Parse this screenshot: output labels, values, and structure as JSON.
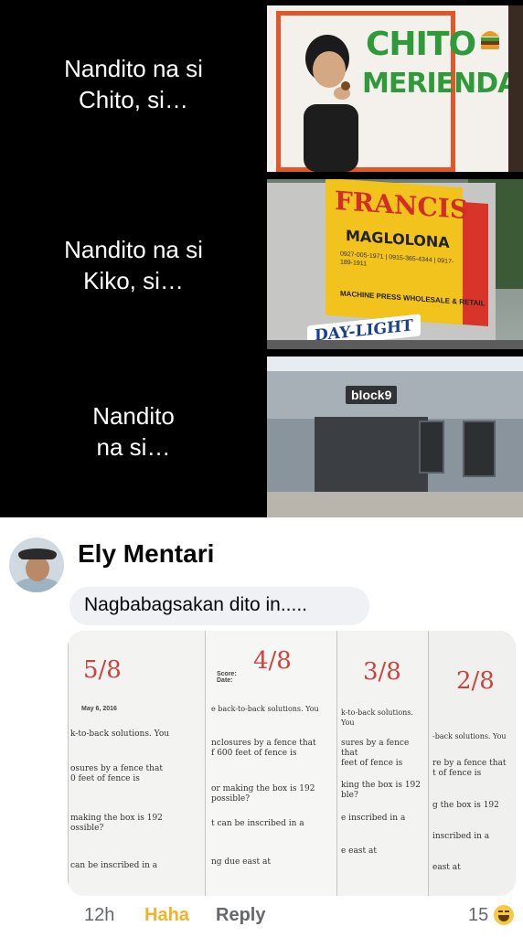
{
  "meme": {
    "rows": [
      {
        "text": "Nandito na si\nChito, si…"
      },
      {
        "text": "Nandito na si\nKiko, si…"
      },
      {
        "text": "Nandito\nna si…"
      }
    ],
    "panel1": {
      "brand_line1": "CHITO",
      "brand_line2": "MERIENDA"
    },
    "panel2": {
      "title": "FRANCIS",
      "subtitle": "MAGLOLONA",
      "contact": "0927-005-1971 | 0915-365-4344 | 0917-189-1911",
      "footer": "MACHINE PRESS WHOLESALE & RETAIL",
      "daylight": "DAY-LIGHT"
    },
    "panel3": {
      "logo": "block9"
    }
  },
  "comment": {
    "author": "Ely Mentari",
    "text": "Nagbabagsakan dito in.....",
    "photo": {
      "sheets": [
        {
          "score": "5/8",
          "date": "May 6, 2016",
          "lines": [
            "k-to-back solutions. You",
            "osures by a fence that\n0 feet of fence is",
            "making the box is 192\nossible?",
            "can be inscribed in a"
          ]
        },
        {
          "score": "4/8",
          "date": "Score:\nDate:",
          "lines": [
            "e back-to-back solutions. You",
            "nclosures by a fence that\nf 600 feet of fence is",
            "or making the box is 192\npossible?",
            "t can be inscribed in a",
            "ng due east at"
          ]
        },
        {
          "score": "3/8",
          "date": "",
          "lines": [
            "k-to-back solutions. You",
            "sures by a fence that\nfeet of fence is",
            "king the box is 192\nble?",
            "e inscribed in a",
            "e east at"
          ]
        },
        {
          "score": "2/8",
          "date": "",
          "lines": [
            "-back solutions. You",
            "re by a fence that\nt of fence is",
            "g the box is 192",
            "inscribed in a",
            "east at"
          ]
        }
      ]
    },
    "time": "12h",
    "reaction_label": "Haha",
    "reply_label": "Reply",
    "reaction_count": "15",
    "reaction_icon": "haha-emoji-icon"
  }
}
